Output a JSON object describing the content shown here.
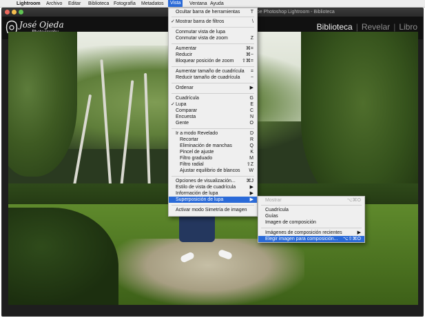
{
  "menubar": {
    "apple_icon": "apple-icon",
    "items": [
      "Lightroom",
      "Archivo",
      "Editar",
      "Biblioteca",
      "Fotografía",
      "Metadatos",
      "Vista",
      "Ventana",
      "Ayuda"
    ],
    "active": "Vista"
  },
  "window": {
    "title": "obe Photoshop Lightroom - Biblioteca",
    "traffic_lights": {
      "close": "#ed6a5e",
      "minimize": "#f5bf4f",
      "maximize": "#61c554"
    }
  },
  "header": {
    "logo_line1": "José Ojeda",
    "logo_line2": "Photography",
    "modules": [
      "Biblioteca",
      "Revelar",
      "Libro"
    ],
    "active_module": "Biblioteca"
  },
  "vista_menu": {
    "items": [
      {
        "label": "Ocultar barra de herramientas",
        "shortcut": "T"
      },
      {
        "label": "Mostrar barra de filtros",
        "shortcut": "\\",
        "checked": true
      },
      {
        "label": "Conmutar vista de lupa",
        "shortcut": ""
      },
      {
        "label": "Conmutar vista de zoom",
        "shortcut": "Z"
      },
      {
        "label": "Aumentar",
        "shortcut": "⌘="
      },
      {
        "label": "Reducir",
        "shortcut": "⌘−"
      },
      {
        "label": "Bloquear posición de zoom",
        "shortcut": "⇧⌘="
      },
      {
        "label": "Aumentar tamaño de cuadrícula",
        "shortcut": "="
      },
      {
        "label": "Reducir tamaño de cuadrícula",
        "shortcut": "−"
      },
      {
        "label": "Ordenar",
        "shortcut": "▶"
      },
      {
        "label": "Cuadrícula",
        "shortcut": "G"
      },
      {
        "label": "Lupa",
        "shortcut": "E",
        "checked": true
      },
      {
        "label": "Comparar",
        "shortcut": "C"
      },
      {
        "label": "Encuesta",
        "shortcut": "N"
      },
      {
        "label": "Gente",
        "shortcut": "O"
      },
      {
        "label": "Ir a modo Revelado",
        "shortcut": "D"
      },
      {
        "label": "Recortar",
        "shortcut": "R"
      },
      {
        "label": "Eliminación de manchas",
        "shortcut": "Q"
      },
      {
        "label": "Pincel de ajuste",
        "shortcut": "K"
      },
      {
        "label": "Filtro graduado",
        "shortcut": "M"
      },
      {
        "label": "Filtro radial",
        "shortcut": "⇧Z"
      },
      {
        "label": "Ajustar equilibrio de blancos",
        "shortcut": "W"
      },
      {
        "label": "Opciones de visualización...",
        "shortcut": "⌘J"
      },
      {
        "label": "Estilo de vista de cuadrícula",
        "shortcut": "▶"
      },
      {
        "label": "Información de lupa",
        "shortcut": "▶"
      },
      {
        "label": "Superposición de lupa",
        "shortcut": "▶"
      },
      {
        "label": "Activar modo Simetría de imagen",
        "shortcut": ""
      }
    ],
    "highlighted": "Superposición de lupa"
  },
  "submenu": {
    "items": [
      {
        "label": "Mostrar",
        "shortcut": "⌥⌘O",
        "disabled": true
      },
      {
        "label": "Cuadrícula",
        "shortcut": ""
      },
      {
        "label": "Guías",
        "shortcut": ""
      },
      {
        "label": "Imagen de composición",
        "shortcut": ""
      },
      {
        "label": "Imágenes de composición recientes",
        "shortcut": "▶"
      },
      {
        "label": "Elegir imagen para composición...",
        "shortcut": "⌥⇧⌘O"
      }
    ],
    "highlighted": "Elegir imagen para composición..."
  },
  "colors": {
    "menu_highlight": "#2a6ad8",
    "menu_bg": "#efefef",
    "window_bg": "#1e1e1e",
    "header_bg": "#111111",
    "active_module": "#f2f2f2",
    "inactive_module": "#8f8f8f"
  }
}
